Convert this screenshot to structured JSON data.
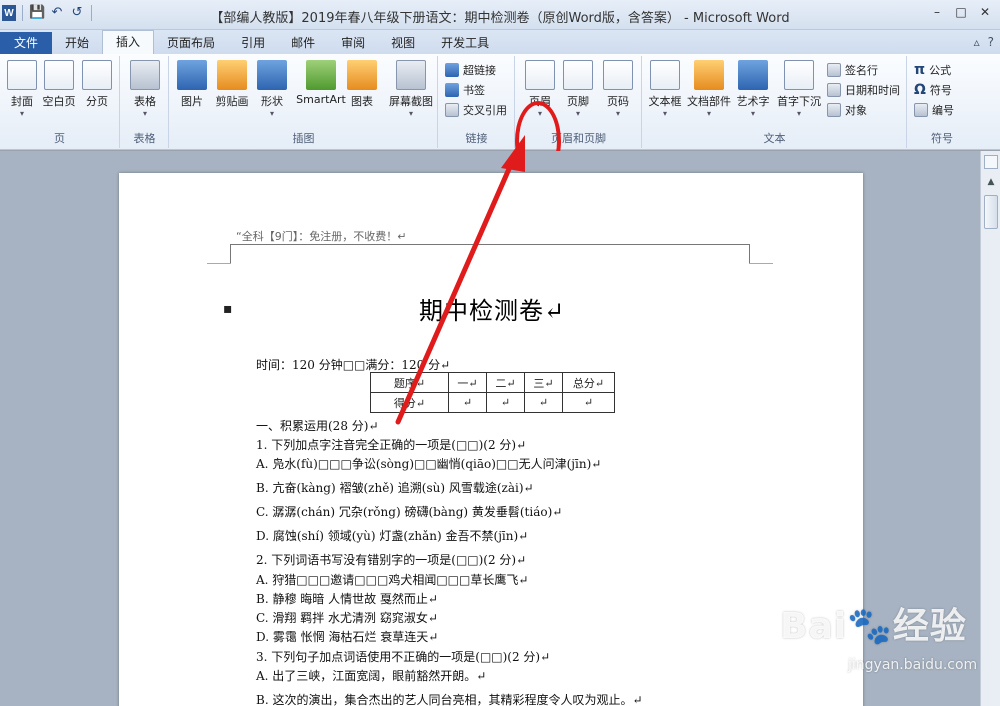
{
  "window": {
    "title": "【部编人教版】2019年春八年级下册语文：期中检测卷（原创Word版，含答案） - Microsoft Word",
    "minimize": "–",
    "maximize": "□",
    "close": "✕"
  },
  "qat": {
    "logo": "W",
    "save": "💾",
    "undo": "↶",
    "redo": "↺"
  },
  "tabs": [
    "文件",
    "开始",
    "插入",
    "页面布局",
    "引用",
    "邮件",
    "审阅",
    "视图",
    "开发工具"
  ],
  "tab_right": {
    "collapse": "▵",
    "help": "?"
  },
  "ribbon": {
    "page": {
      "label": "页",
      "cover": "封面",
      "blank": "空白页",
      "break": "分页"
    },
    "table": {
      "label": "表格",
      "table": "表格"
    },
    "illustrations": {
      "label": "插图",
      "picture": "图片",
      "clipart": "剪贴画",
      "shapes": "形状",
      "smartart": "SmartArt",
      "chart": "图表",
      "screenshot": "屏幕截图"
    },
    "links": {
      "label": "链接",
      "hyperlink": "超链接",
      "bookmark": "书签",
      "crossref": "交叉引用"
    },
    "headerfooter": {
      "label": "页眉和页脚",
      "header": "页眉",
      "footer": "页脚",
      "pagenum": "页码"
    },
    "text": {
      "label": "文本",
      "textbox": "文本框",
      "quickparts": "文档部件",
      "wordart": "艺术字",
      "dropcap": "首字下沉",
      "signature": "签名行",
      "datetime": "日期和时间",
      "object": "对象"
    },
    "symbols": {
      "label": "符号",
      "equation": "公式",
      "symbol": "符号",
      "number": "编号"
    }
  },
  "document": {
    "header_text": "“全科【9门】：免注册，不收费！↵",
    "title": "期中检测卷↵",
    "meta": "时间：120 分钟□□满分：120 分↵",
    "table": {
      "row1": [
        "题序↵",
        "一↵",
        "二↵",
        "三↵",
        "总分↵"
      ],
      "row2": [
        "得分↵",
        "↵",
        "↵",
        "↵",
        "↵"
      ]
    },
    "lines": [
      "一、积累运用(28 分)↵",
      "1.  下列加点字注音完全正确的一项是(□□)(2 分)↵",
      "A.  凫水(fù)□□□争讼(sòng)□□幽悄(qiāo)□□无人问津(jīn)↵",
      "B.  亢奋(kàng)  褶皱(zhě)  追溯(sù)  风雪载途(zài)↵",
      "C.  潺潺(chán)  冗杂(rǒng)  磅礴(bàng)  黄发垂髫(tiáo)↵",
      "D.  腐蚀(shí)  领域(yù)  灯盏(zhǎn)  金吾不禁(jīn)↵",
      "2.  下列词语书写没有错别字的一项是(□□)(2 分)↵",
      "A.  狩猎□□□邀请□□□鸡犬相闻□□□草长鹰飞↵",
      "B.  静穆  晦暗  人情世故  戛然而止↵",
      "C.  滑翔  羁拌  水尤清洌  窈窕淑女↵",
      "D.  雾霭  怅惘  海枯石烂  衰草连天↵",
      "3.  下列句子加点词语使用不正确的一项是(□□)(2 分)↵",
      "A.  出了三峡，江面宽阔，眼前豁然开朗。↵",
      "B.  这次的演出，集合杰出的艺人同台亮相，其精彩程度令人叹为观止。↵"
    ]
  },
  "watermark": {
    "brand": "Bai🐾经验",
    "url": "jingyan.baidu.com"
  },
  "colors": {
    "accent": "#2a5ea8",
    "annotation": "#e01b1b"
  }
}
